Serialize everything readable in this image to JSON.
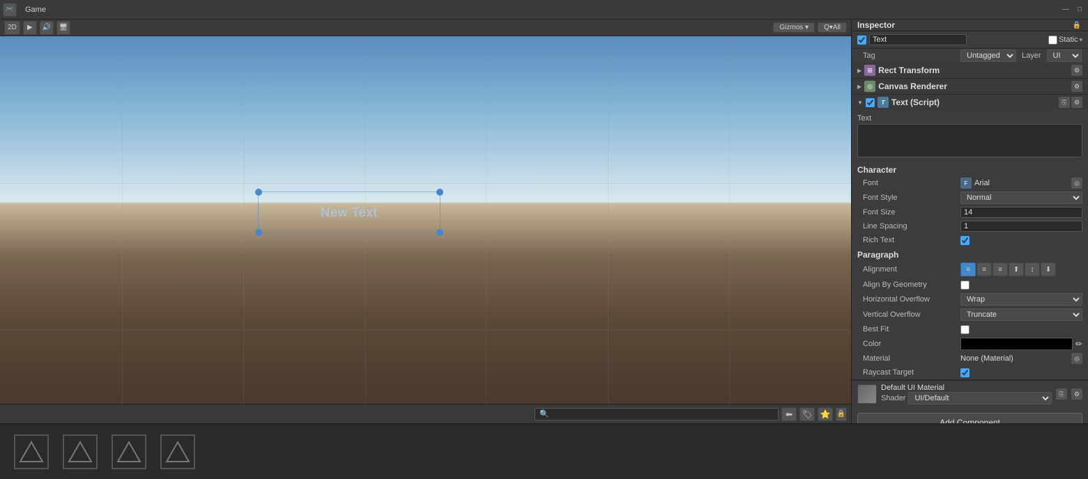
{
  "window": {
    "title": "Game",
    "inspector_title": "Inspector"
  },
  "game_toolbar": {
    "label": "Game",
    "gizmos_btn": "Gizmos ▾",
    "search_placeholder": "Q▾All"
  },
  "top_row": {
    "checkbox_checked": true,
    "component_name": "Text",
    "static_label": "Static",
    "static_dropdown": "▾"
  },
  "tag_layer": {
    "tag_label": "Tag",
    "tag_value": "Untagged",
    "layer_label": "Layer",
    "layer_value": "UI"
  },
  "rect_transform": {
    "name": "Rect Transform"
  },
  "canvas_renderer": {
    "name": "Canvas Renderer"
  },
  "text_script": {
    "name": "Text (Script)",
    "text_label": "Text",
    "text_value": "New Text"
  },
  "character": {
    "section_label": "Character",
    "font_label": "Font",
    "font_value": "Arial",
    "font_style_label": "Font Style",
    "font_style_value": "Normal",
    "font_size_label": "Font Size",
    "font_size_value": "14",
    "line_spacing_label": "Line Spacing",
    "line_spacing_value": "1",
    "rich_text_label": "Rich Text",
    "rich_text_checked": true
  },
  "paragraph": {
    "section_label": "Paragraph",
    "alignment_label": "Alignment",
    "align_by_geometry_label": "Align By Geometry",
    "align_by_geometry_checked": false,
    "horizontal_overflow_label": "Horizontal Overflow",
    "horizontal_overflow_value": "Wrap",
    "vertical_overflow_label": "Vertical Overflow",
    "vertical_overflow_value": "Truncate",
    "best_fit_label": "Best Fit",
    "best_fit_checked": false,
    "color_label": "Color",
    "material_label": "Material",
    "material_value": "None (Material)",
    "raycast_target_label": "Raycast Target",
    "raycast_target_checked": true
  },
  "default_material": {
    "name": "Default UI Material",
    "shader_label": "Shader",
    "shader_value": "UI/Default"
  },
  "add_component": {
    "label": "Add Component"
  },
  "scene": {
    "text_display": "New Text"
  },
  "viewport_bottom": {
    "search_placeholder": "🔍"
  }
}
